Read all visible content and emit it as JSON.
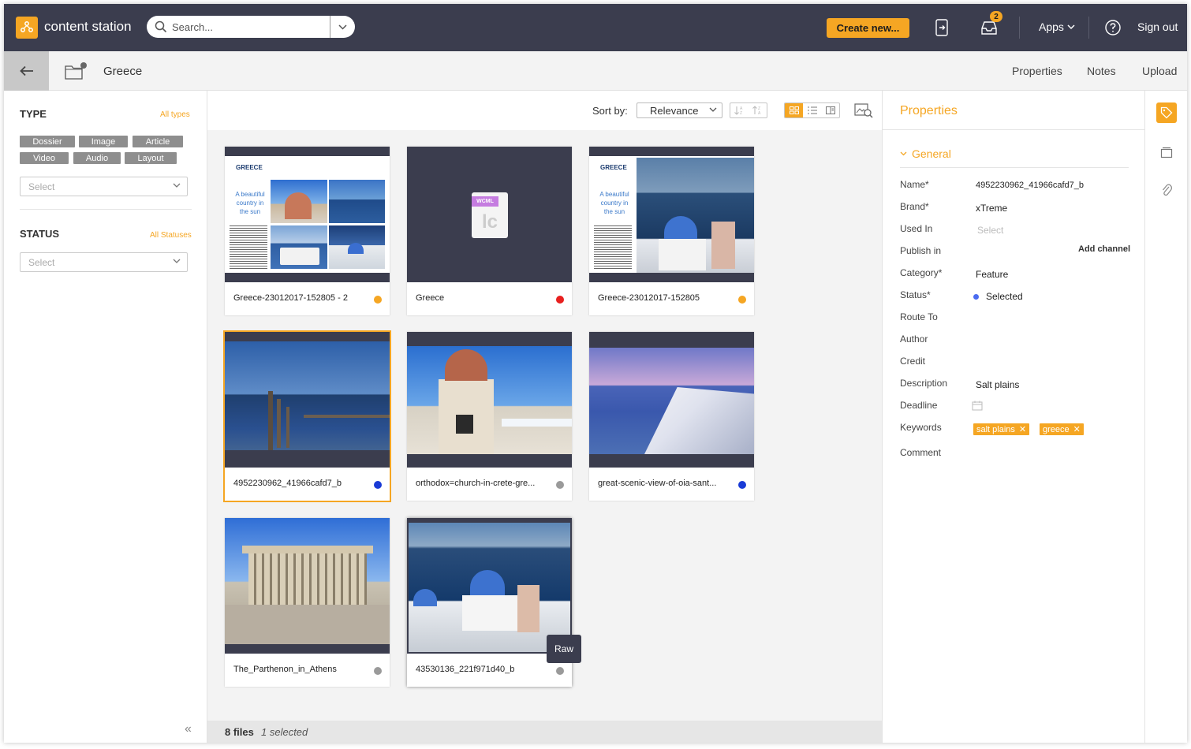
{
  "header": {
    "app_title": "content station",
    "search_placeholder": "Search...",
    "create_label": "Create new...",
    "inbox_badge": "2",
    "apps_label": "Apps",
    "signout_label": "Sign out"
  },
  "subbar": {
    "crumb": "Greece",
    "tabs": [
      "Properties",
      "Notes",
      "Upload"
    ]
  },
  "filters": {
    "type_label": "TYPE",
    "type_link": "All types",
    "types": [
      "Dossier",
      "Image",
      "Article",
      "Video",
      "Audio",
      "Layout"
    ],
    "type_select": "Select",
    "status_label": "STATUS",
    "status_link": "All Statuses",
    "status_select": "Select"
  },
  "toolbar": {
    "sort_label": "Sort by:",
    "sort_value": "Relevance"
  },
  "colors": {
    "accent": "#f5a623",
    "topbar": "#3b3d4e",
    "status_orange": "#f5a623",
    "status_red": "#e8201f",
    "status_blue": "#1a3bd6",
    "status_grey": "#9a9a9a"
  },
  "files": [
    {
      "name": "Greece-23012017-152805 - 2",
      "status_color": "#f5a623",
      "thumb": "layout",
      "selected": false
    },
    {
      "name": "Greece",
      "status_color": "#e8201f",
      "thumb": "wcml",
      "selected": false
    },
    {
      "name": "Greece-23012017-152805",
      "status_color": "#f5a623",
      "thumb": "layout2",
      "selected": false
    },
    {
      "name": "4952230962_41966cafd7_b",
      "status_color": "#1a3bd6",
      "thumb": "saltplains",
      "selected": true
    },
    {
      "name": "orthodox=church-in-crete-gre...",
      "status_color": "#9a9a9a",
      "thumb": "church",
      "selected": false
    },
    {
      "name": "great-scenic-view-of-oia-sant...",
      "status_color": "#1a3bd6",
      "thumb": "oia",
      "selected": false
    },
    {
      "name": "The_Parthenon_in_Athens",
      "status_color": "#9a9a9a",
      "thumb": "parthenon",
      "selected": false
    },
    {
      "name": "43530136_221f971d40_b",
      "status_color": "#9a9a9a",
      "thumb": "santorini",
      "selected": false
    }
  ],
  "layout_thumb": {
    "heading": "GREECE",
    "tagline_1": "A beautiful",
    "tagline_2": "country in",
    "tagline_3": "the sun"
  },
  "wcml_thumb": {
    "tag": "WCML",
    "letters": "lc"
  },
  "tooltip": "Raw",
  "statusbar": {
    "files": "8 files",
    "selected": "1 selected"
  },
  "properties": {
    "title": "Properties",
    "section": "General",
    "fields": [
      {
        "label": "Name*",
        "value": "4952230962_41966cafd7_b"
      },
      {
        "label": "Brand*",
        "value": "xTreme"
      },
      {
        "label": "Used In",
        "placeholder": "Select"
      },
      {
        "label": "Publish in",
        "action": "Add channel"
      },
      {
        "label": "Category*",
        "value": "Feature"
      },
      {
        "label": "Status*",
        "value": "Selected"
      },
      {
        "label": "Route To",
        "value": ""
      },
      {
        "label": "Author",
        "value": ""
      },
      {
        "label": "Credit",
        "value": ""
      },
      {
        "label": "Description",
        "value": "Salt plains"
      },
      {
        "label": "Deadline",
        "value": ""
      },
      {
        "label": "Keywords",
        "value": ""
      },
      {
        "label": "Comment",
        "value": ""
      }
    ],
    "keywords": [
      "salt plains",
      "greece"
    ]
  }
}
